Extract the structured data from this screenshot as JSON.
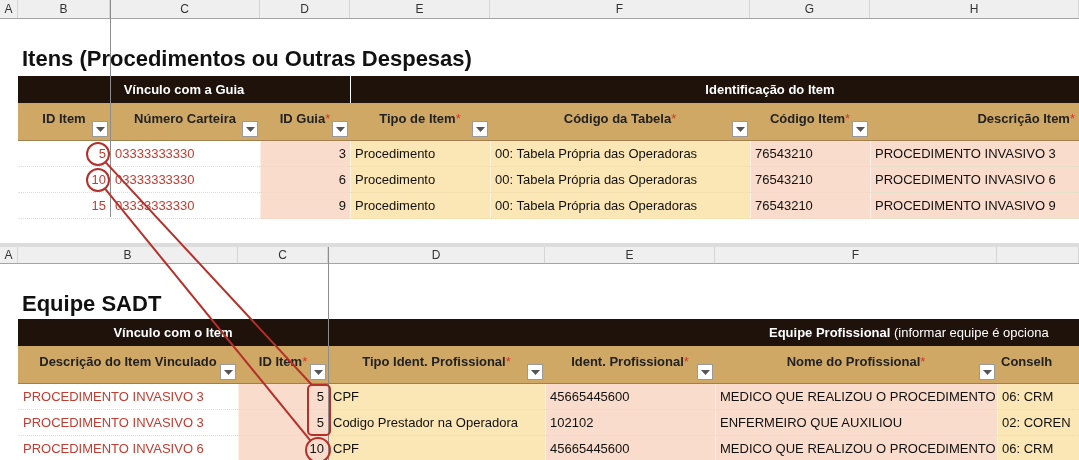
{
  "sheets": [
    {
      "column_letters": [
        "A",
        "B",
        "C",
        "D",
        "E",
        "F",
        "G",
        "H"
      ],
      "title": "Itens (Procedimentos ou Outras Despesas)",
      "groups": [
        {
          "label": "Vínculo com a Guia",
          "columns": [
            {
              "label": "ID Item",
              "filter": true
            },
            {
              "label": "Número Carteira",
              "filter": true
            },
            {
              "label": "ID Guia",
              "mark": "*",
              "filter": true
            }
          ]
        },
        {
          "label": "Identificação do Item",
          "columns": [
            {
              "label": "Tipo de Item",
              "mark": "*",
              "filter": true
            },
            {
              "label": "Código da Tabela",
              "mark": "*",
              "filter": true
            },
            {
              "label": "Código Item",
              "mark": "*",
              "filter": true
            },
            {
              "label": "Descrição Item",
              "mark": "*",
              "filter": false
            }
          ]
        }
      ],
      "rows": [
        [
          "5",
          "03333333330",
          "3",
          "Procedimento",
          "00: Tabela Própria das Operadoras",
          "76543210",
          "PROCEDIMENTO INVASIVO 3"
        ],
        [
          "10",
          "03333333330",
          "6",
          "Procedimento",
          "00: Tabela Própria das Operadoras",
          "76543210",
          "PROCEDIMENTO INVASIVO 6"
        ],
        [
          "15",
          "03333333330",
          "9",
          "Procedimento",
          "00: Tabela Própria das Operadoras",
          "76543210",
          "PROCEDIMENTO INVASIVO 9"
        ]
      ]
    },
    {
      "column_letters": [
        "A",
        "B",
        "C",
        "D",
        "E",
        "F"
      ],
      "title": "Equipe SADT",
      "groups": [
        {
          "label": "Vínculo com o Item",
          "columns": [
            {
              "label": "Descrição do Item Vinculado",
              "filter": true
            },
            {
              "label": "ID Item",
              "mark": "*",
              "filter": true
            }
          ]
        },
        {
          "label": "**Equipe Profissional** (informar equipe é opciona",
          "columns": [
            {
              "label": "Tipo Ident. Profissional",
              "mark": "*",
              "filter": true
            },
            {
              "label": "Ident. Profissional",
              "mark": "*",
              "filter": true
            },
            {
              "label": "Nome do Profissional",
              "mark": "*",
              "filter": true
            },
            {
              "label": "Conselh",
              "filter": false
            }
          ]
        }
      ],
      "rows": [
        [
          "PROCEDIMENTO INVASIVO 3",
          "5",
          "CPF",
          "45665445600",
          "MEDICO QUE REALIZOU O PROCEDIMENTO",
          "06: CRM"
        ],
        [
          "PROCEDIMENTO INVASIVO 3",
          "5",
          "Codigo Prestador na Operadora",
          "102102",
          "ENFERMEIRO QUE AUXILIOU",
          "02: COREN"
        ],
        [
          "PROCEDIMENTO INVASIVO 6",
          "10",
          "CPF",
          "45665445600",
          "MEDICO QUE REALIZOU O PROCEDIMENTO",
          "06: CRM"
        ]
      ]
    }
  ]
}
